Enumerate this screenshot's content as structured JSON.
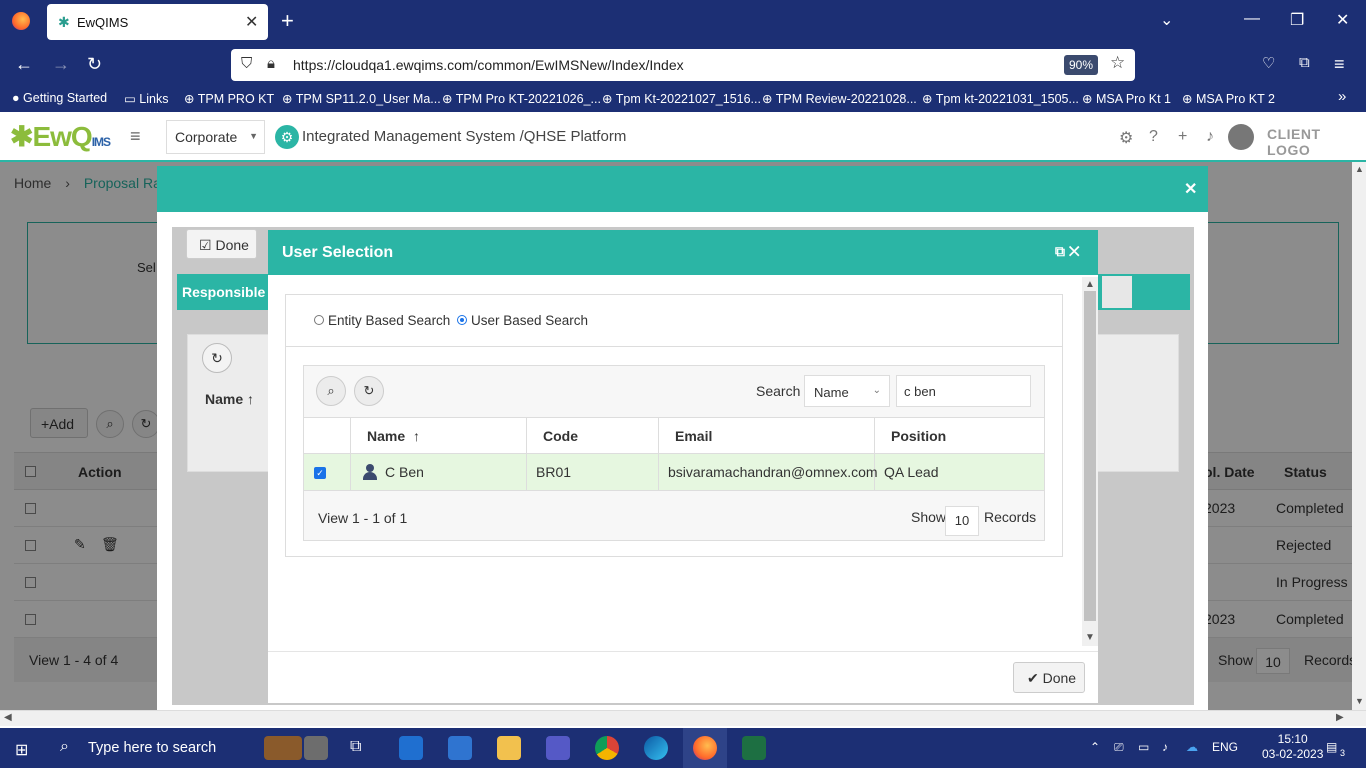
{
  "browser": {
    "tab_title": "EwQIMS",
    "url": "https://cloudqa1.ewqims.com/common/EwIMSNew/Index/Index",
    "zoom": "90%",
    "bookmarks": [
      "Getting Started",
      "Links",
      "TPM PRO KT",
      "TPM SP11.2.0_User Ma...",
      "TPM Pro KT-20221026_...",
      "Tpm Kt-20221027_1516...",
      "TPM Review-20221028...",
      "Tpm kt-20221031_1505...",
      "MSA Pro Kt 1",
      "MSA Pro KT 2"
    ]
  },
  "header": {
    "logo_text": "EwQ",
    "logo_small": "IMS",
    "org_select": "Corporate",
    "title": "Integrated Management System /QHSE Platform",
    "client_logo": "CLIENT LOGO"
  },
  "background": {
    "breadcrumb_home": "Home",
    "breadcrumb_current": "Proposal Rati",
    "select_label": "Sel",
    "add_label": "+Add",
    "action_header": "Action",
    "date_header": "ol. Date",
    "status_header": "Status",
    "rows": [
      {
        "date": "2023",
        "status": "Completed"
      },
      {
        "date": "",
        "status": "Rejected"
      },
      {
        "date": "",
        "status": "In Progress"
      },
      {
        "date": "2023",
        "status": "Completed"
      }
    ],
    "footer_view": "View 1 - 4 of 4",
    "footer_show": "Show",
    "footer_count": "10",
    "footer_records": "Records"
  },
  "outer_modal": {
    "done_label": "Done",
    "responsible_label": "Responsible P",
    "name_header": "Name"
  },
  "user_selection": {
    "title": "User Selection",
    "radio_entity": "Entity Based Search",
    "radio_user": "User Based Search",
    "search_label": "Search",
    "search_field": "Name",
    "search_value": "c ben",
    "columns": [
      "Name",
      "Code",
      "Email",
      "Position"
    ],
    "row": {
      "name": "C Ben",
      "code": "BR01",
      "email": "bsivaramachandran@omnex.com",
      "position": "QA Lead"
    },
    "view_text": "View 1 - 1 of 1",
    "show_label": "Show",
    "show_count": "10",
    "records_label": "Records",
    "done_label": "Done"
  },
  "taskbar": {
    "search_placeholder": "Type here to search",
    "language": "ENG",
    "time": "15:10",
    "date": "03-02-2023",
    "notifications": "3"
  },
  "colors": {
    "teal": "#2bb5a5",
    "navy": "#1c2f74",
    "selected_row": "#e6f7e0"
  }
}
